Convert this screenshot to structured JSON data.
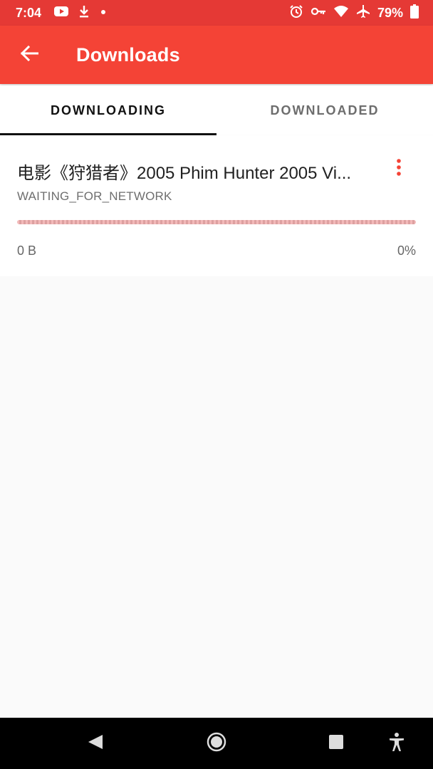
{
  "status_bar": {
    "time": "7:04",
    "battery": "79%",
    "left_icons": [
      "youtube-icon",
      "download-icon",
      "dot-icon"
    ],
    "right_icons": [
      "alarm-icon",
      "key-icon",
      "wifi-icon",
      "airplane-icon",
      "battery-icon"
    ]
  },
  "app_bar": {
    "title": "Downloads",
    "back_icon": "arrow-back-icon"
  },
  "tabs": [
    {
      "label": "DOWNLOADING",
      "active": true
    },
    {
      "label": "DOWNLOADED",
      "active": false
    }
  ],
  "downloads": [
    {
      "title": "电影《狩猎者》2005 Phim Hunter 2005 Vi...",
      "status": "WAITING_FOR_NETWORK",
      "size": "0 B",
      "percent": "0%",
      "progress": 0
    }
  ],
  "nav_bar": {
    "icons": [
      "back-nav-icon",
      "home-nav-icon",
      "recents-nav-icon",
      "accessibility-icon"
    ]
  },
  "colors": {
    "accent": "#f44336",
    "status_bar": "#e53935",
    "tab_indicator": "#111111",
    "background": "#fafafa"
  }
}
